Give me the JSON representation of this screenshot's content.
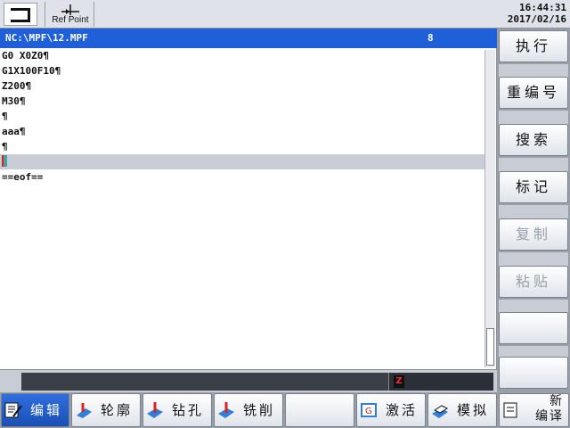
{
  "topbar": {
    "mode_icon": "jog-bracket-icon",
    "refpoint_label": "Ref Point",
    "time": "16:44:31",
    "date": "2017/02/16"
  },
  "editor": {
    "path": "NC:\\MPF\\12.MPF",
    "count": "8",
    "lines": [
      "G0 X0Z0¶",
      "G1X100F10¶",
      "Z200¶",
      "M30¶",
      "¶",
      "aaa¶",
      "¶",
      "",
      "==eof=="
    ],
    "current_line_index": 7
  },
  "vertical_softkeys": {
    "execute": "执行",
    "renumber": "重编号",
    "search": "搜索",
    "mark": "标记",
    "copy": "复制",
    "paste": "粘贴"
  },
  "horizontal_softkeys": {
    "edit": "编辑",
    "contour": "轮廓",
    "drill": "钻孔",
    "mill": "铣削",
    "activate": "激活",
    "simulate": "模拟",
    "new_line1": "新",
    "new_line2": "编译"
  },
  "colors": {
    "header_blue": "#1f5fd8",
    "current_line": "#c8ccd4",
    "active_tab": "#2f6fe0"
  }
}
